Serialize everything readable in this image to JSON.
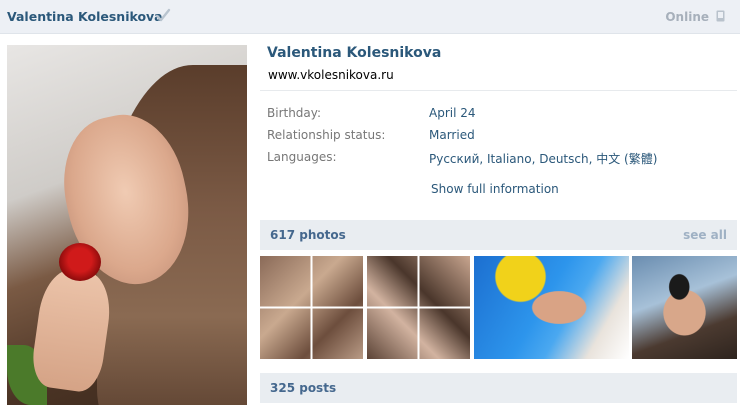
{
  "header": {
    "name": "Valentina Kolesnikova",
    "status": "Online",
    "icons": {
      "verified": "checkmark-icon",
      "mobile": "mobile-phone-icon"
    }
  },
  "profile": {
    "full_name": "Valentina Kolesnikova",
    "website": "www.vkolesnikova.ru",
    "fields": [
      {
        "label": "Birthday:",
        "value": "April 24"
      },
      {
        "label": "Relationship status:",
        "value": "Married"
      },
      {
        "label": "Languages:",
        "value": "Русский, Italiano, Deutsch, 中文 (繁體)"
      }
    ],
    "show_full": "Show full information"
  },
  "photos": {
    "title": "617 photos",
    "see_all": "see all"
  },
  "posts": {
    "title": "325 posts"
  },
  "colors": {
    "link": "#2b587a",
    "section_bg": "#e9edf1",
    "header_bg": "#edf0f5",
    "label": "#777777"
  }
}
